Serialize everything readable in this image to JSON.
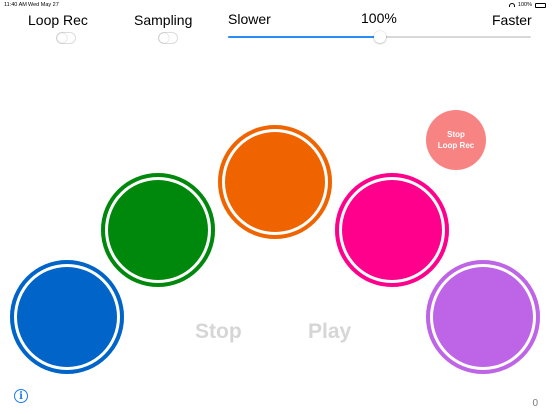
{
  "status_bar": {
    "time": "11:40 AM",
    "date": "Wed May 27",
    "battery": "100%"
  },
  "controls": {
    "loop_rec": {
      "label": "Loop Rec",
      "on": false
    },
    "sampling": {
      "label": "Sampling",
      "on": false
    },
    "speed": {
      "slower_label": "Slower",
      "faster_label": "Faster",
      "value_text": "100%",
      "position": 0.5
    }
  },
  "pads": [
    {
      "name": "blue",
      "color": "#0064c8"
    },
    {
      "name": "green",
      "color": "#00880c"
    },
    {
      "name": "orange",
      "color": "#f06400"
    },
    {
      "name": "pink",
      "color": "#ff008c"
    },
    {
      "name": "purple",
      "color": "#be64e6"
    }
  ],
  "stop_loop_rec": {
    "line1": "Stop",
    "line2": "Loop Rec",
    "color": "#f88383"
  },
  "transport": {
    "stop_label": "Stop",
    "play_label": "Play"
  },
  "counter": "0",
  "colors": {
    "accent": "#2a8df5",
    "info": "#1a7bf0"
  }
}
